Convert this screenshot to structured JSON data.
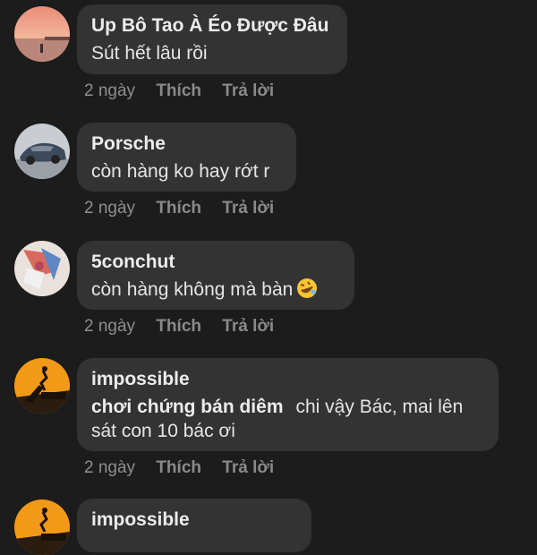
{
  "comments": [
    {
      "author": "Up Bô Tao À  Éo Được Đâu",
      "text": "Sút hết lâu rồi",
      "time": "2 ngày",
      "like": "Thích",
      "reply": "Trả lời"
    },
    {
      "author": "Porsche",
      "text": "còn hàng ko hay rớt r",
      "time": "2 ngày",
      "like": "Thích",
      "reply": "Trả lời"
    },
    {
      "author": "5conchut",
      "text": "còn hàng không mà bàn",
      "emoji": "rolling-on-floor-laughing-emoji",
      "time": "2 ngày",
      "like": "Thích",
      "reply": "Trả lời"
    },
    {
      "author": "impossible",
      "mention": "chơi chứng bán diêm",
      "text": "chi vậy Bác, mai lên sát con 10 bác ơi",
      "time": "2 ngày",
      "like": "Thích",
      "reply": "Trả lời"
    },
    {
      "author": "impossible"
    }
  ]
}
